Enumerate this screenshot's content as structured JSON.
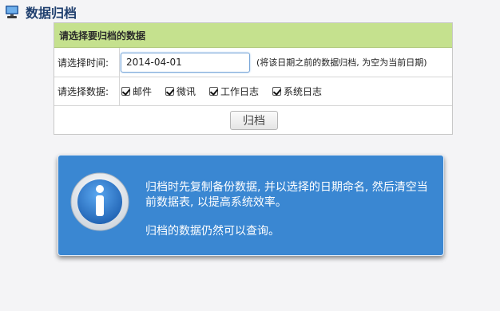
{
  "page": {
    "title": "数据归档"
  },
  "panel": {
    "header": "请选择要归档的数据",
    "date_row": {
      "label": "请选择时间:",
      "value": "2014-04-01",
      "hint": "(将该日期之前的数据归档, 为空为当前日期)"
    },
    "types_row": {
      "label": "请选择数据:",
      "options": [
        {
          "label": "邮件",
          "checked": true
        },
        {
          "label": "微讯",
          "checked": true
        },
        {
          "label": "工作日志",
          "checked": true
        },
        {
          "label": "系统日志",
          "checked": true
        }
      ]
    },
    "submit_label": "归档"
  },
  "info": {
    "line1": "归档时先复制备份数据, 并以选择的日期命名, 然后清空当前数据表, 以提高系统效率。",
    "line2": "归档的数据仍然可以查询。"
  },
  "colors": {
    "header_bg": "#c5e18e",
    "info_bg": "#3a87d2",
    "title_text": "#1f3f6e"
  },
  "icons": [
    "computer-icon",
    "info-icon",
    "checkmark-icon"
  ]
}
